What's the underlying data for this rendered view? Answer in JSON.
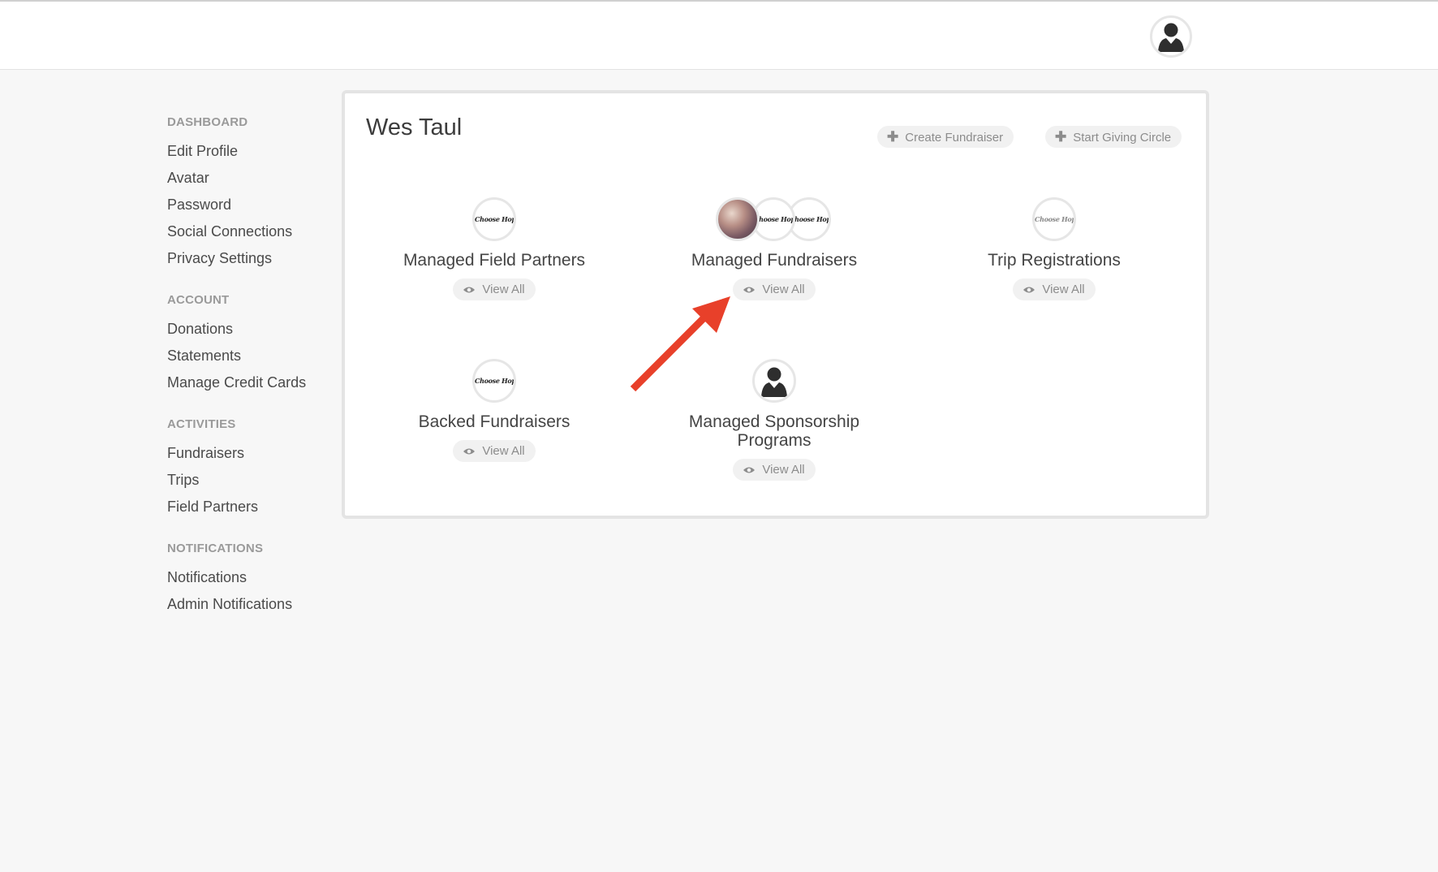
{
  "user": {
    "name": "Wes Taul"
  },
  "header": {
    "avatar_icon": "user-silhouette-icon"
  },
  "sidebar": {
    "groups": [
      {
        "heading": "DASHBOARD",
        "items": [
          "Edit Profile",
          "Avatar",
          "Password",
          "Social Connections",
          "Privacy Settings"
        ]
      },
      {
        "heading": "ACCOUNT",
        "items": [
          "Donations",
          "Statements",
          "Manage Credit Cards"
        ]
      },
      {
        "heading": "ACTIVITIES",
        "items": [
          "Fundraisers",
          "Trips",
          "Field Partners"
        ]
      },
      {
        "heading": "NOTIFICATIONS",
        "items": [
          "Notifications",
          "Admin Notifications"
        ]
      }
    ]
  },
  "actions": {
    "create_fundraiser": "Create Fundraiser",
    "start_giving_circle": "Start Giving Circle"
  },
  "tiles": {
    "managed_field_partners": {
      "label": "Managed Field Partners",
      "view_all": "View All",
      "logo_text": "Choose Hope"
    },
    "managed_fundraisers": {
      "label": "Managed Fundraisers",
      "view_all": "View All",
      "logo_text": "Choose Hope"
    },
    "trip_registrations": {
      "label": "Trip Registrations",
      "view_all": "View All",
      "logo_text": "Choose Hope"
    },
    "backed_fundraisers": {
      "label": "Backed Fundraisers",
      "view_all": "View All",
      "logo_text": "Choose Hope"
    },
    "managed_sponsorship_programs": {
      "label": "Managed Sponsorship Programs",
      "view_all": "View All"
    }
  },
  "colors": {
    "annotation_arrow": "#e8402a",
    "background": "#f7f7f7",
    "pill_background": "#f1f1f1"
  }
}
